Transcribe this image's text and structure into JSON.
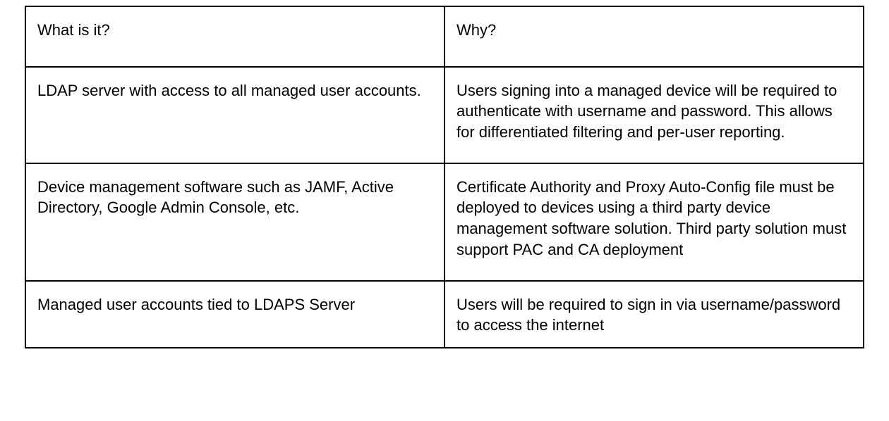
{
  "table": {
    "headers": {
      "col1": "What is it?",
      "col2": "Why?"
    },
    "rows": [
      {
        "what": "LDAP server with access to all managed user accounts.",
        "why": "Users signing into a managed device will be required to authenticate with username and password. This allows for differentiated filtering and per-user reporting."
      },
      {
        "what": "Device management software such as JAMF, Active Directory, Google Admin Console, etc.",
        "why": "Certificate Authority and Proxy Auto-Config file must be deployed to devices using a third party device management software solution. Third party solution must support PAC and CA deployment"
      },
      {
        "what": "Managed user accounts tied to LDAPS Server",
        "why": "Users will be required to sign in via username/password to access the internet"
      }
    ]
  }
}
